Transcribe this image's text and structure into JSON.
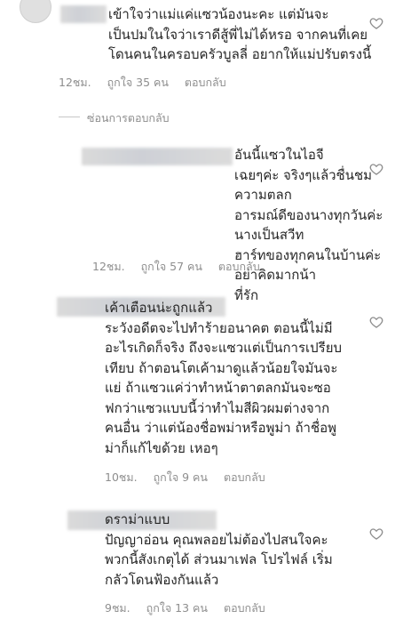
{
  "comments": [
    {
      "lines": "เข้าใจว่าแม่แค่แซวน้องนะคะ แต่มันจะ\nเป็นปมในใจว่าเราดีสู้พี่ไม่ได้หรอ จากคนที่เคย\nโดนคนในครอบครัวบูลลี่ อยากให้แม่ปรับตรงนี้",
      "time": "12ชม.",
      "likes": "ถูกใจ 35 คน",
      "reply": "ตอบกลับ"
    },
    {
      "lines": "อันนี้แซวในไอจี\nเฉยๆค่ะ จริงๆแล้วชื่นชมความตลก\nอารมณ์ดีของนางทุกวันค่ะ นางเป็นสวีท\nฮาร์ทของทุกคนในบ้านค่ะ อย่าคิดมากน้า\nที่รัก",
      "time": "12ชม.",
      "likes": "ถูกใจ 57 คน",
      "reply": "ตอบกลับ"
    },
    {
      "lines": "เค้าเตือนน่ะถูกแล้ว\nระวังอดีตจะไปทำร้ายอนาคต ตอนนี้ไม่มี\nอะไรเกิดก็จริง ถึงจะแซวแต่เป็นการเปรียบ\nเทียบ ถ้าตอนโตเค้ามาดูแล้วน้อยใจมันจะ\nแย่ ถ้าแซวแค่ว่าทำหน้าตาตลกมันจะซอ\nฟกว่าแซวแบบนี้ว่าทำไมสีผิวผมต่างจาก\nคนอื่น ว่าแต่น้องชื่อพม่าหรือพูม่า ถ้าชื่อพู\nม่าก็แก้ไขด้วย เหอๆ",
      "time": "10ชม.",
      "likes": "ถูกใจ 9 คน",
      "reply": "ตอบกลับ"
    },
    {
      "lines": "ดราม่าแบบ\nปัญญาอ่อน คุณพลอยไม่ต้องไปสนใจคะ\nพวกนี้สังเกตุได้ ส่วนมาเฟล โปรไฟล์ เริ่ม\nกลัวโดนฟ้องกันแล้ว",
      "time": "9ชม.",
      "likes": "ถูกใจ 13 คน",
      "reply": "ตอบกลับ"
    }
  ],
  "hide_replies": "ซ่อนการตอบกลับ",
  "icons": {
    "like": "heart-outline-icon"
  },
  "colors": {
    "text": "#262626",
    "meta": "#8e8e8e"
  }
}
